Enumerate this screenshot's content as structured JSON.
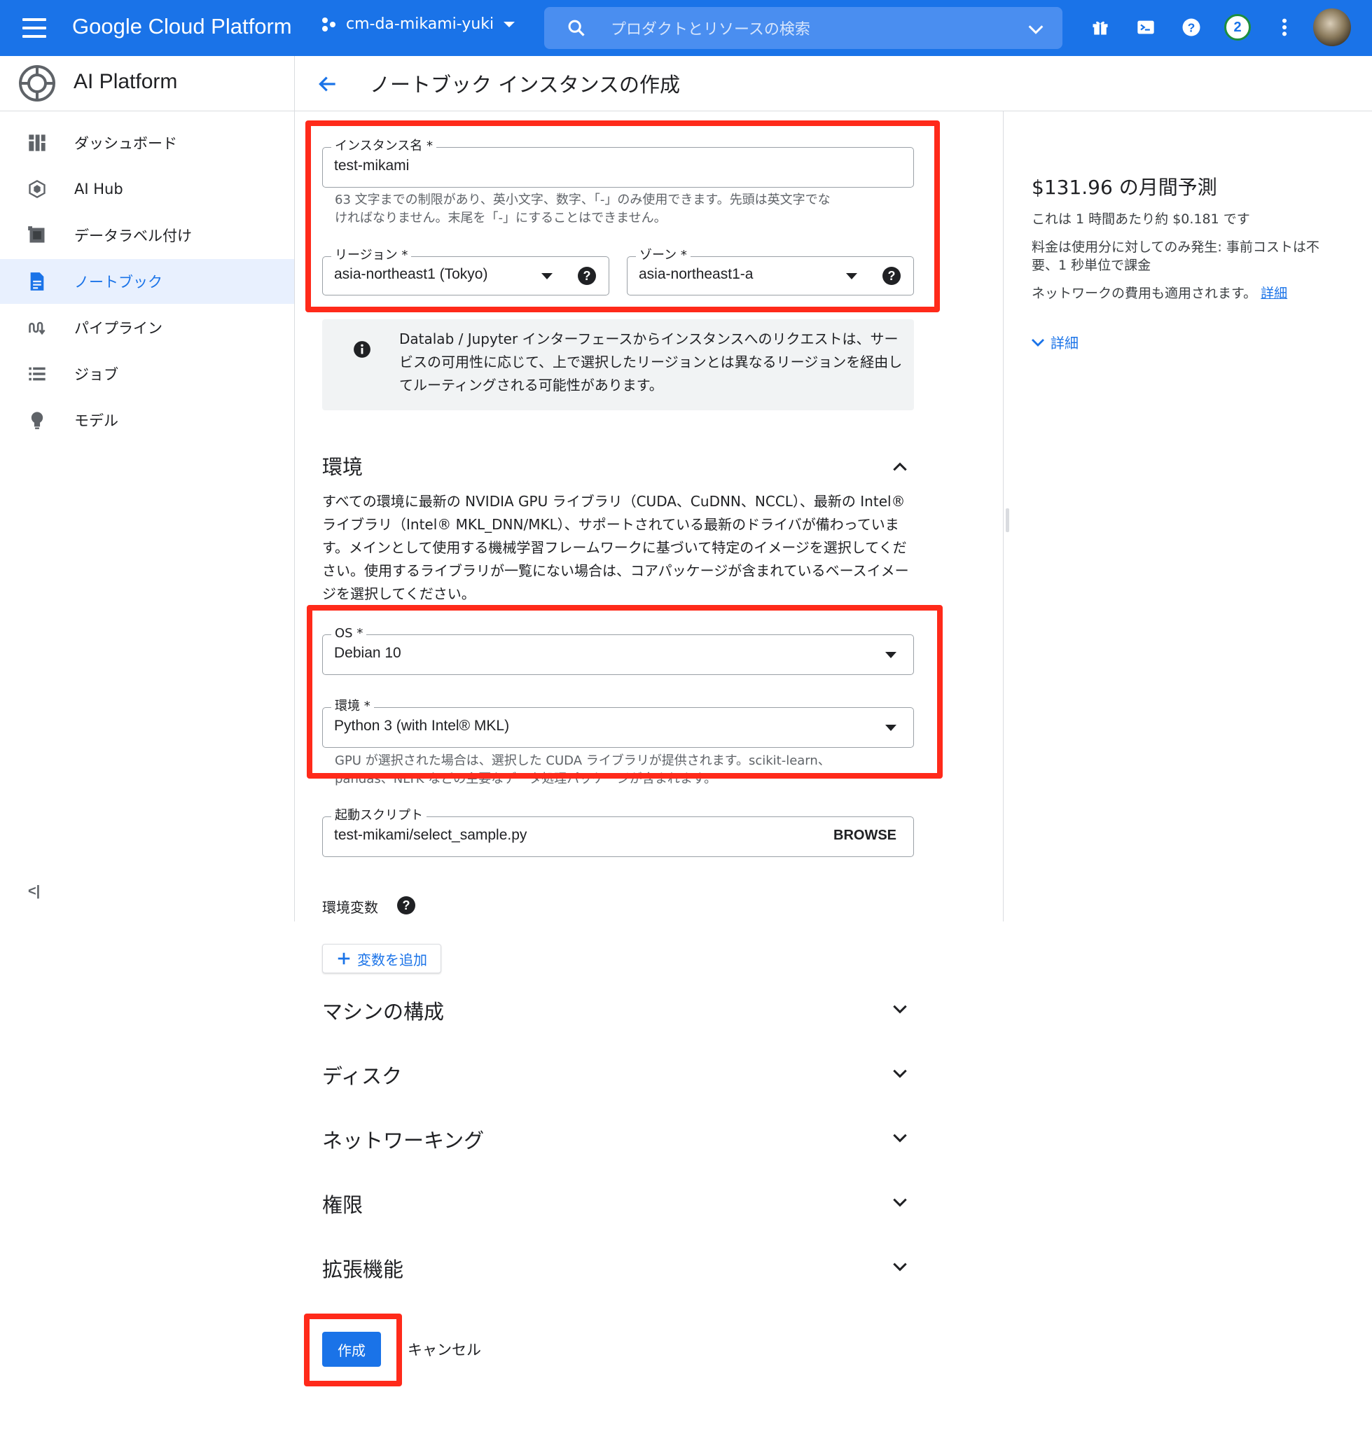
{
  "topbar": {
    "brand": "Google Cloud Platform",
    "project": "cm-da-mikami-yuki",
    "search_placeholder": "プロダクトとリソースの検索",
    "notifications_count": "2"
  },
  "product": {
    "title": "AI Platform"
  },
  "page": {
    "title": "ノートブック インスタンスの作成"
  },
  "sidebar": {
    "items": [
      {
        "label": "ダッシュボード",
        "icon": "dashboard-icon"
      },
      {
        "label": "AI Hub",
        "icon": "hub-icon"
      },
      {
        "label": "データラベル付け",
        "icon": "labeling-icon"
      },
      {
        "label": "ノートブック",
        "icon": "notebook-icon",
        "active": true
      },
      {
        "label": "パイプライン",
        "icon": "pipeline-icon"
      },
      {
        "label": "ジョブ",
        "icon": "jobs-icon"
      },
      {
        "label": "モデル",
        "icon": "model-icon"
      }
    ],
    "collapse_label": "<|"
  },
  "form": {
    "instance_name": {
      "label": "インスタンス名 *",
      "value": "test-mikami",
      "hint_line1": "63 文字までの制限があり、英小文字、数字、「-」のみ使用できます。先頭は英文字でな",
      "hint_line2": "ければなりません。末尾を「-」にすることはできません。"
    },
    "region": {
      "label": "リージョン *",
      "value": "asia-northeast1 (Tokyo)"
    },
    "zone": {
      "label": "ゾーン *",
      "value": "asia-northeast1-a"
    },
    "info_message": "Datalab / Jupyter インターフェースからインスタンスへのリクエストは、サービスの可用性に応じて、上で選択したリージョンとは異なるリージョンを経由してルーティングされる可能性があります。",
    "environment_section": {
      "title": "環境",
      "description": "すべての環境に最新の NVIDIA GPU ライブラリ（CUDA、CuDNN、NCCL）、最新の Intel® ライブラリ（Intel® MKL_DNN/MKL）、サポートされている最新のドライバが備わっています。メインとして使用する機械学習フレームワークに基づいて特定のイメージを選択してください。使用するライブラリが一覧にない場合は、コアパッケージが含まれているベースイメージを選択してください。"
    },
    "os": {
      "label": "OS *",
      "value": "Debian 10"
    },
    "environment": {
      "label": "環境 *",
      "value": "Python 3 (with Intel® MKL)",
      "hint_line1": "GPU が選択された場合は、選択した CUDA ライブラリが提供されます。scikit-learn、",
      "hint_line2": "pandas、NLTK などの主要なデータ処理パッケージが含まれます。"
    },
    "startup_script": {
      "label": "起動スクリプト",
      "value": "test-mikami/select_sample.py",
      "browse_label": "BROWSE"
    },
    "env_vars": {
      "label": "環境変数",
      "add_label": "変数を追加"
    },
    "sections": [
      "マシンの構成",
      "ディスク",
      "ネットワーキング",
      "権限",
      "拡張機能"
    ],
    "create_label": "作成",
    "cancel_label": "キャンセル"
  },
  "pricing": {
    "title": "$131.96 の月間予測",
    "hourly": "これは 1 時間あたり約 $0.181 です",
    "note_line1": "料金は使用分に対してのみ発生: 事前コストは不",
    "note_line2": "要、1 秒単位で課金",
    "network_note": "ネットワークの費用も適用されます。",
    "network_link": "詳細",
    "details_label": "詳細"
  },
  "colors": {
    "brand_blue": "#1a73e8",
    "highlight_red": "#ff2a1a",
    "active_nav_bg": "#e8f0fe"
  }
}
